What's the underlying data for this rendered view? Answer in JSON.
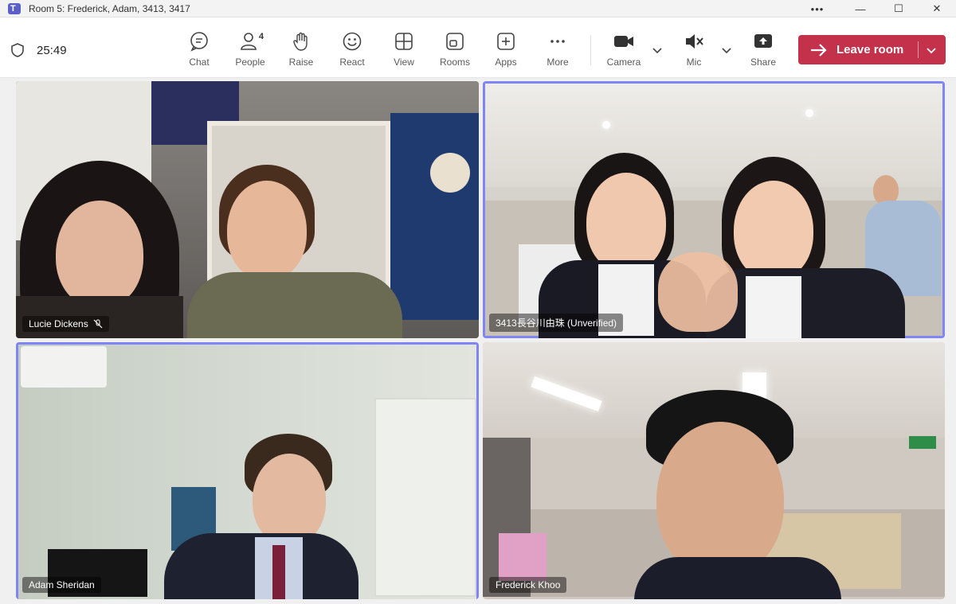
{
  "window": {
    "title": "Room 5: Frederick, Adam, 3413, 3417",
    "controls": {
      "more": "•••",
      "minimize": "—",
      "maximize": "☐",
      "close": "✕"
    }
  },
  "toolbar": {
    "timer": "25:49",
    "buttons": [
      {
        "label": "Chat",
        "icon": "chat-icon"
      },
      {
        "label": "People",
        "icon": "people-icon",
        "badge": "4"
      },
      {
        "label": "Raise",
        "icon": "raise-hand-icon"
      },
      {
        "label": "React",
        "icon": "smiley-icon"
      },
      {
        "label": "View",
        "icon": "grid-icon"
      },
      {
        "label": "Rooms",
        "icon": "rooms-icon"
      },
      {
        "label": "Apps",
        "icon": "apps-plus-icon"
      },
      {
        "label": "More",
        "icon": "more-dots-icon"
      },
      {
        "label": "Camera",
        "icon": "camera-icon"
      },
      {
        "label": "Mic",
        "icon": "mic-muted-icon"
      },
      {
        "label": "Share",
        "icon": "share-icon"
      }
    ],
    "leave": {
      "label": "Leave room",
      "color": "#c4314b"
    }
  },
  "participants": [
    {
      "name": "Lucie Dickens",
      "muted": true
    },
    {
      "name": "3413長谷川由珠 (Unverified)",
      "speaking": true
    },
    {
      "name": "Adam Sheridan",
      "speaking": true
    },
    {
      "name": "Frederick Khoo"
    }
  ],
  "colors": {
    "accent": "#5b5fc7",
    "speaking_border": "#7f85f5"
  }
}
